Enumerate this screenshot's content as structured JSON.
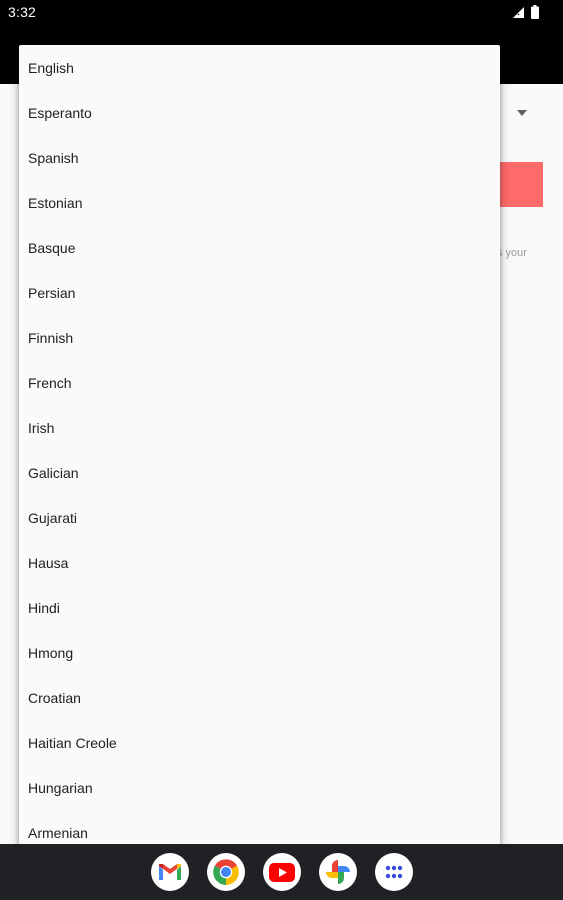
{
  "status_bar": {
    "time": "3:32",
    "icons": [
      "signal-icon",
      "battery-icon"
    ]
  },
  "background": {
    "hint_text": "s your",
    "button_color": "#ff6b6b"
  },
  "language_menu": {
    "items": [
      "English",
      "Esperanto",
      "Spanish",
      "Estonian",
      "Basque",
      "Persian",
      "Finnish",
      "French",
      "Irish",
      "Galician",
      "Gujarati",
      "Hausa",
      "Hindi",
      "Hmong",
      "Croatian",
      "Haitian Creole",
      "Hungarian",
      "Armenian"
    ]
  },
  "dock": {
    "apps": [
      "gmail-icon",
      "chrome-icon",
      "youtube-icon",
      "photos-icon",
      "app-drawer-icon"
    ]
  }
}
